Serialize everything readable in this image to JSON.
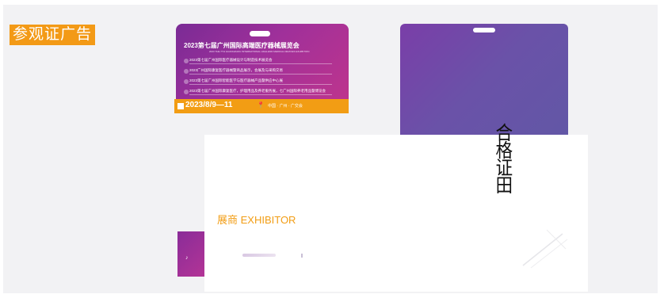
{
  "section": {
    "title": "参观证广告"
  },
  "front_badge": {
    "expo_title": "2023第七届广州国际高端医疗器械展览会",
    "expo_subtitle": "2023 THE 7TH GUANGZHOU INTERNATIONAL HIGH-END MEDICAL DEVICES EXHIBITION",
    "agenda": [
      "2023第七届广州国际医疗器械设计与制造技术展览会",
      "2023广州国际康复医疗器械暨商品展示，会展及与采购交易",
      "2023第七届广州国际智能医学与医疗器械产品暨供应中心展",
      "2023第七届广州国际康复医疗，护理用品及养老服务展，七广州国际养老用品暨博览会"
    ],
    "date": "2023/8/9—11",
    "location": "中国 · 广州 · 广交会"
  },
  "card": {
    "exhibitor_label": "展商  EXHIBITOR",
    "vertical_text": "合格证田"
  },
  "colors": {
    "accent_orange": "#f29d14",
    "badge_purple": "#7a2b95",
    "badge_back": "#6a52a8"
  }
}
